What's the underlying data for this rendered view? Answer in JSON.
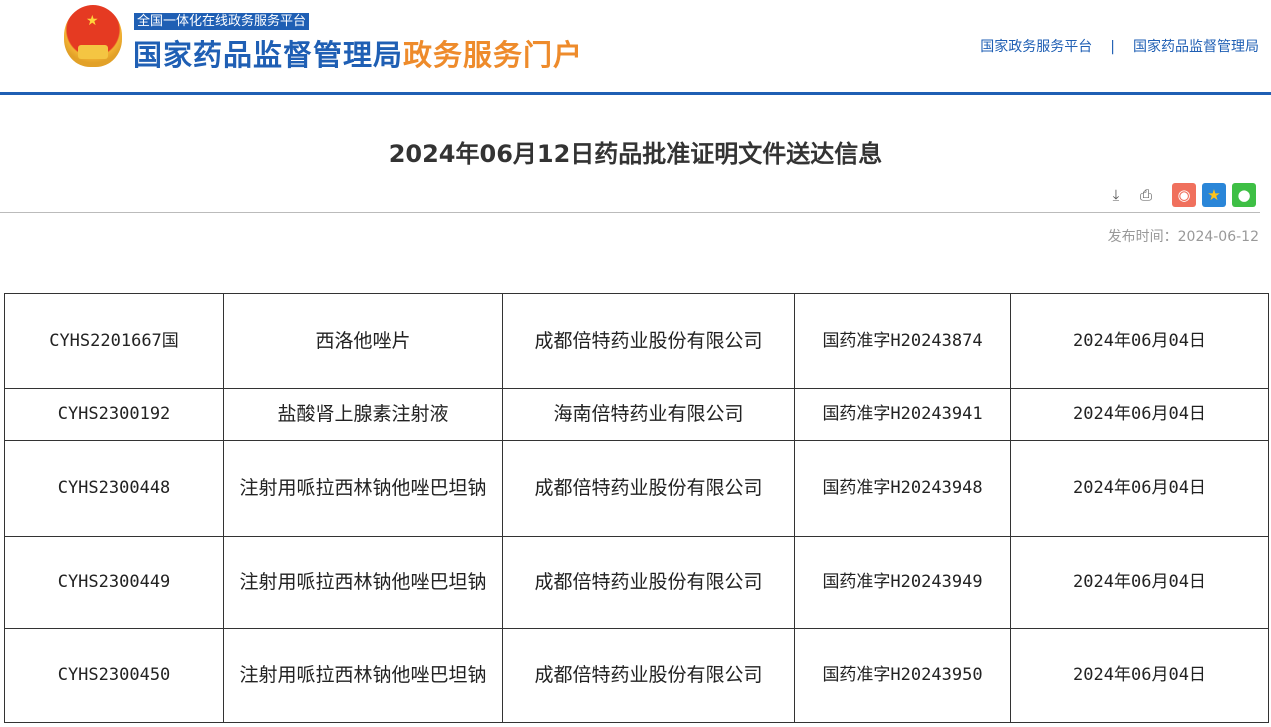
{
  "header": {
    "platform_badge": "全国一体化在线政务服务平台",
    "site_name": "国家药品监督管理局",
    "site_suffix": "政务服务门户",
    "links": [
      "国家政务服务平台",
      "国家药品监督管理局"
    ],
    "separator": "|"
  },
  "page": {
    "title": "2024年06月12日药品批准证明文件送达信息",
    "publish_label": "发布时间：",
    "publish_date": "2024-06-12"
  },
  "tools": [
    "download-icon",
    "print-icon",
    "weibo-icon",
    "qzone-icon",
    "wechat-icon"
  ],
  "rows": [
    [
      "CYHS2201667国",
      "西洛他唑片",
      "成都倍特药业股份有限公司",
      "国药准字H20243874",
      "2024年06月04日"
    ],
    [
      "CYHS2300192",
      "盐酸肾上腺素注射液",
      "海南倍特药业有限公司",
      "国药准字H20243941",
      "2024年06月04日"
    ],
    [
      "CYHS2300448",
      "注射用哌拉西林钠他唑巴坦钠",
      "成都倍特药业股份有限公司",
      "国药准字H20243948",
      "2024年06月04日"
    ],
    [
      "CYHS2300449",
      "注射用哌拉西林钠他唑巴坦钠",
      "成都倍特药业股份有限公司",
      "国药准字H20243949",
      "2024年06月04日"
    ],
    [
      "CYHS2300450",
      "注射用哌拉西林钠他唑巴坦钠",
      "成都倍特药业股份有限公司",
      "国药准字H20243950",
      "2024年06月04日"
    ]
  ]
}
